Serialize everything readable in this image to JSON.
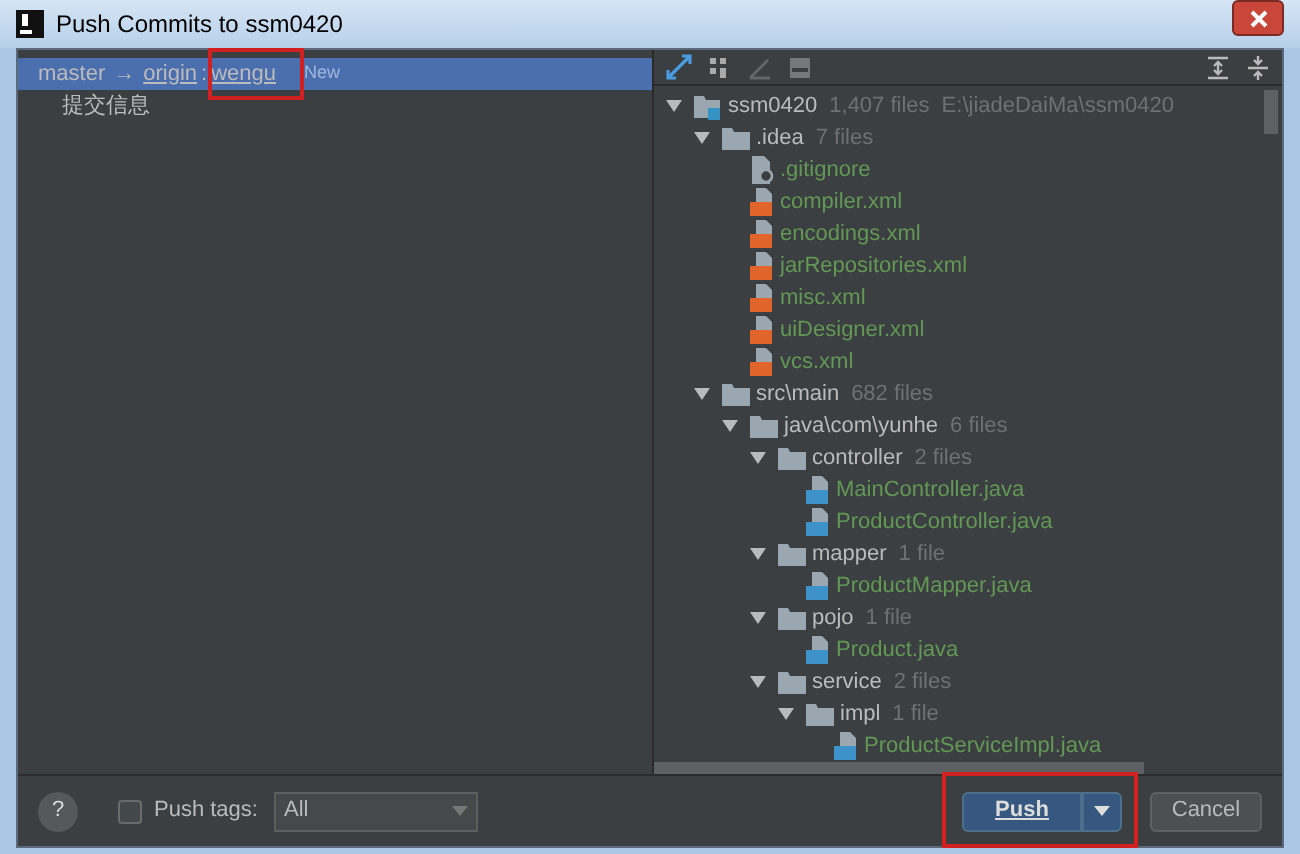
{
  "window": {
    "title": "Push Commits to ssm0420"
  },
  "commits": {
    "branch": {
      "source": "master",
      "arrow": "→",
      "remote": "origin",
      "separator": ":",
      "target": "wengu",
      "badge": "New",
      "selected": true,
      "highlighted": true
    },
    "items": [
      {
        "message": "提交信息"
      }
    ]
  },
  "tree": [
    {
      "kind": "module",
      "name": "ssm0420",
      "count": "1,407 files",
      "path": "E:\\jiadeDaiMa\\ssm0420",
      "expanded": true,
      "children": [
        {
          "kind": "folder",
          "name": ".idea",
          "count": "7 files",
          "expanded": true,
          "children": [
            {
              "kind": "git",
              "name": ".gitignore"
            },
            {
              "kind": "xml",
              "name": "compiler.xml"
            },
            {
              "kind": "xml",
              "name": "encodings.xml"
            },
            {
              "kind": "xml",
              "name": "jarRepositories.xml"
            },
            {
              "kind": "xml",
              "name": "misc.xml"
            },
            {
              "kind": "xml",
              "name": "uiDesigner.xml"
            },
            {
              "kind": "xml",
              "name": "vcs.xml"
            }
          ]
        },
        {
          "kind": "folder",
          "name": "src\\main",
          "count": "682 files",
          "expanded": true,
          "children": [
            {
              "kind": "folder",
              "name": "java\\com\\yunhe",
              "count": "6 files",
              "expanded": true,
              "children": [
                {
                  "kind": "folder",
                  "name": "controller",
                  "count": "2 files",
                  "expanded": true,
                  "children": [
                    {
                      "kind": "java",
                      "name": "MainController.java"
                    },
                    {
                      "kind": "java",
                      "name": "ProductController.java"
                    }
                  ]
                },
                {
                  "kind": "folder",
                  "name": "mapper",
                  "count": "1 file",
                  "expanded": true,
                  "children": [
                    {
                      "kind": "java",
                      "name": "ProductMapper.java"
                    }
                  ]
                },
                {
                  "kind": "folder",
                  "name": "pojo",
                  "count": "1 file",
                  "expanded": true,
                  "children": [
                    {
                      "kind": "java",
                      "name": "Product.java"
                    }
                  ]
                },
                {
                  "kind": "folder",
                  "name": "service",
                  "count": "2 files",
                  "expanded": true,
                  "children": [
                    {
                      "kind": "folder",
                      "name": "impl",
                      "count": "1 file",
                      "expanded": true,
                      "children": [
                        {
                          "kind": "java",
                          "name": "ProductServiceImpl.java"
                        }
                      ]
                    }
                  ]
                }
              ]
            }
          ]
        }
      ]
    }
  ],
  "footer": {
    "help": "?",
    "push_tags": {
      "label": "Push tags:",
      "checked": false,
      "value": "All"
    },
    "push_button": {
      "label": "Push",
      "highlighted": true
    },
    "cancel_button": {
      "label": "Cancel"
    }
  }
}
